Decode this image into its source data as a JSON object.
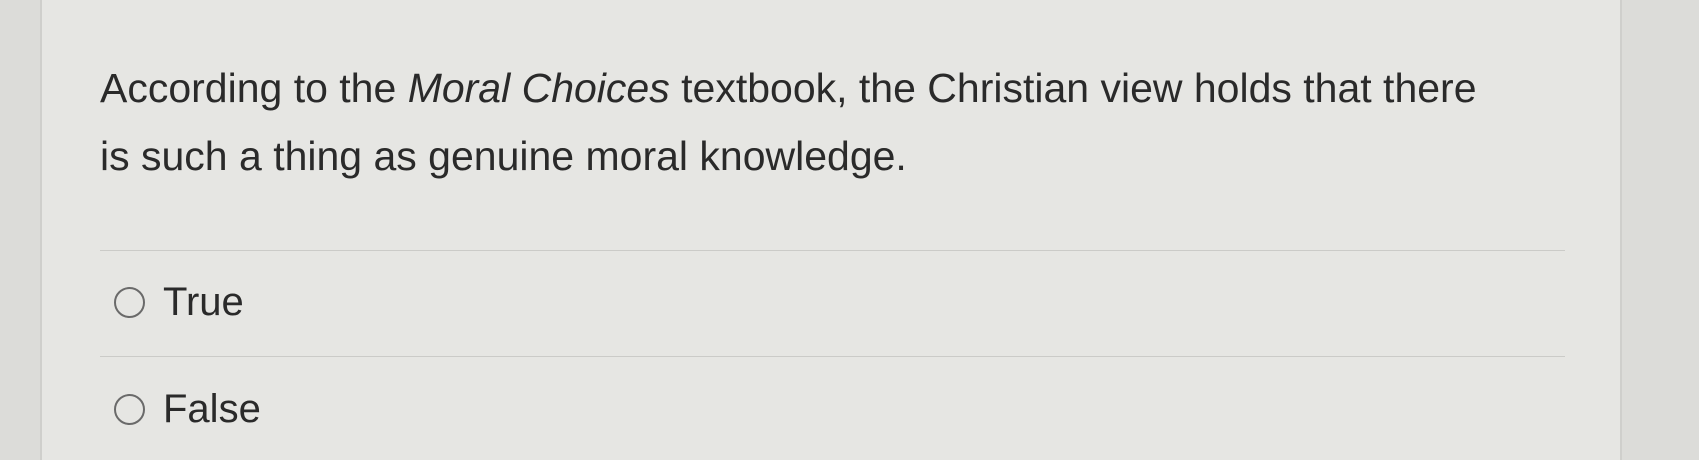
{
  "question": {
    "text_before": "According to the ",
    "text_italic": "Moral Choices",
    "text_after": " textbook, the Christian view holds that there is such a thing as genuine moral knowledge."
  },
  "options": [
    {
      "label": "True",
      "selected": false
    },
    {
      "label": "False",
      "selected": false
    }
  ],
  "colors": {
    "background": "#e6e6e3",
    "text": "#2a2a2a",
    "radio_border": "#6a6a6a",
    "divider": "#cbcbc8"
  },
  "icons": {
    "radio": "radio-unchecked-icon"
  }
}
